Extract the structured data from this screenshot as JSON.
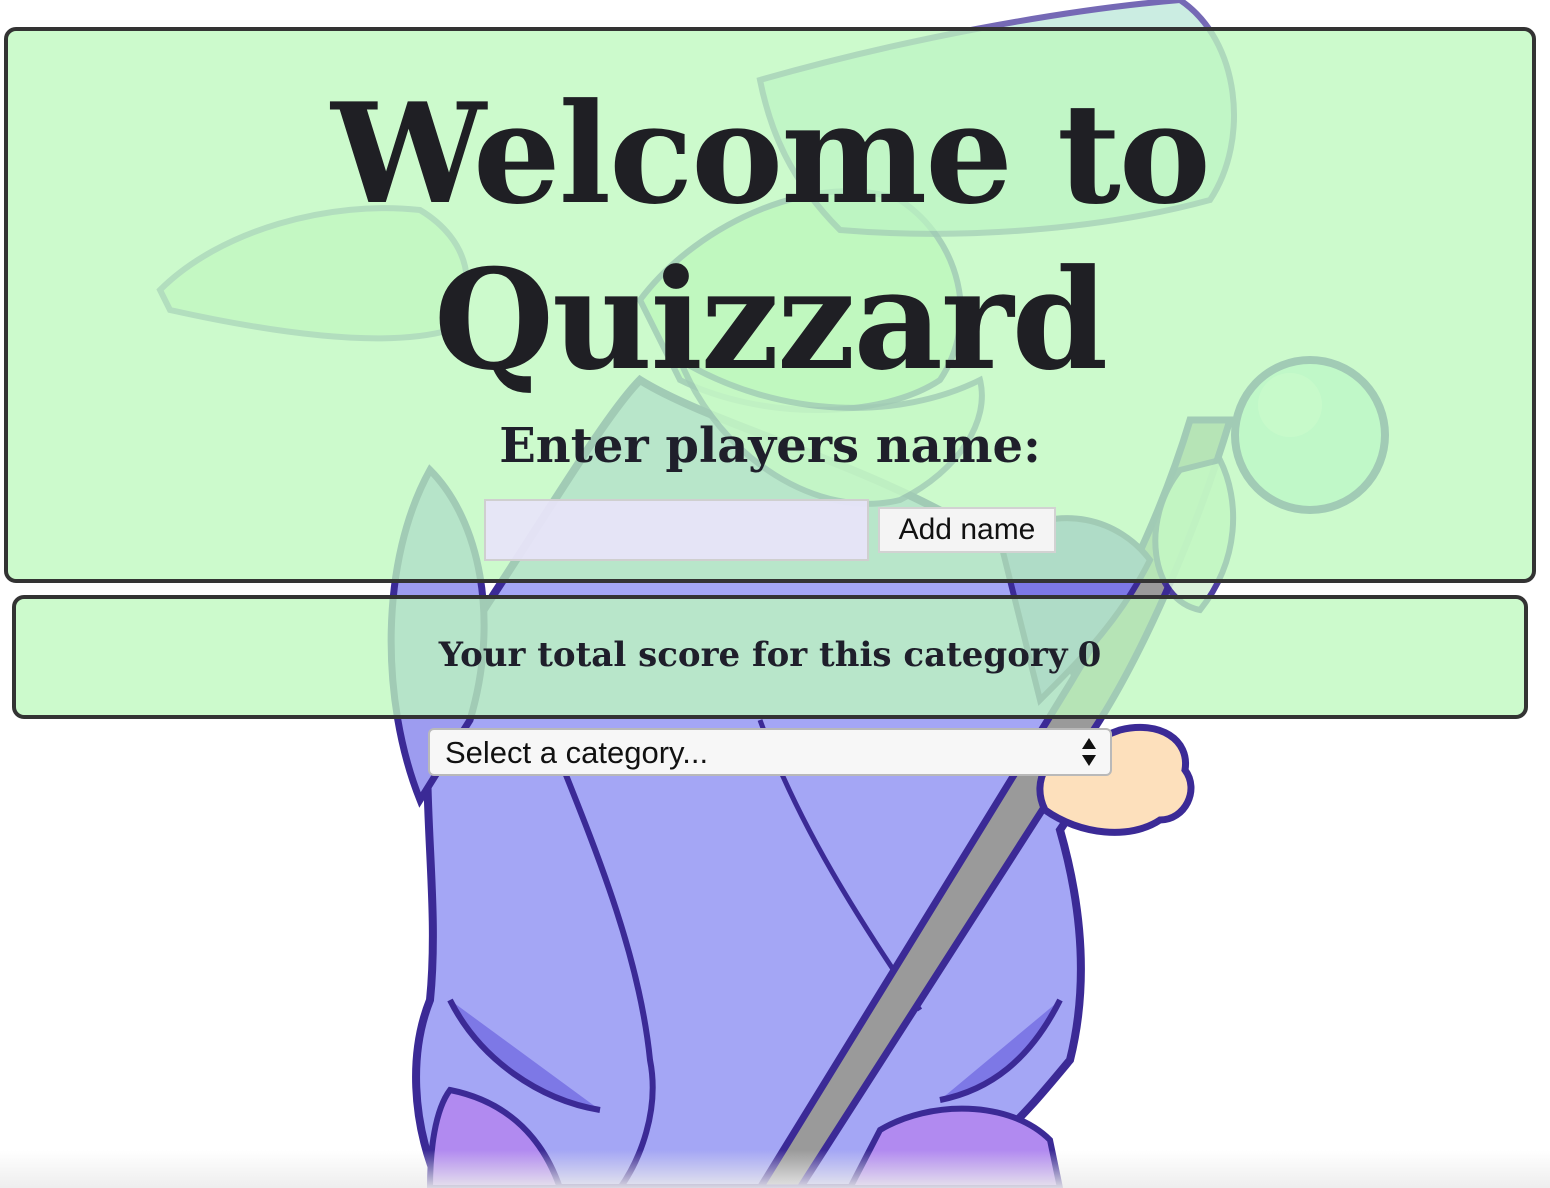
{
  "header": {
    "title": "Welcome to Quizzard",
    "subtitle": "Enter players name:"
  },
  "name_form": {
    "input_value": "",
    "input_placeholder": "",
    "add_button_label": "Add name"
  },
  "score": {
    "label": "Your total score for this category",
    "value": "0"
  },
  "category_select": {
    "selected_label": "Select a category..."
  },
  "background": {
    "illustration": "wizard-mascot",
    "colors": {
      "panel_fill": "#bef8be",
      "panel_border": "#333333",
      "robe": "#a4a6f5",
      "outline": "#3b2a96",
      "skin": "#bdf2b8",
      "staff": "#9a9a9a",
      "orb": "#c9f6ec",
      "hand": "#fde0bc"
    }
  },
  "icons": {
    "select_arrows": "up-down-arrows-icon"
  }
}
